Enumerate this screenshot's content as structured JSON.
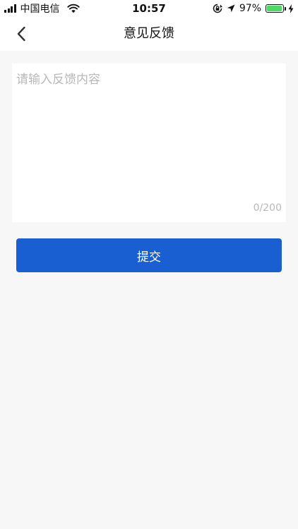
{
  "status_bar": {
    "carrier": "中国电信",
    "time": "10:57",
    "battery_percent": "97%",
    "battery_level": 0.97
  },
  "nav": {
    "title": "意见反馈"
  },
  "feedback": {
    "placeholder": "请输入反馈内容",
    "value": "",
    "counter": "0/200"
  },
  "actions": {
    "submit_label": "提交"
  },
  "colors": {
    "primary": "#1a5fd2",
    "background": "#f7f7f7",
    "battery_green": "#4cd964",
    "placeholder": "#b8b8b8"
  },
  "icons": [
    "signal-icon",
    "wifi-icon",
    "orientation-lock-icon",
    "location-arrow-icon",
    "battery-icon",
    "charging-bolt-icon",
    "back-chevron-icon"
  ]
}
